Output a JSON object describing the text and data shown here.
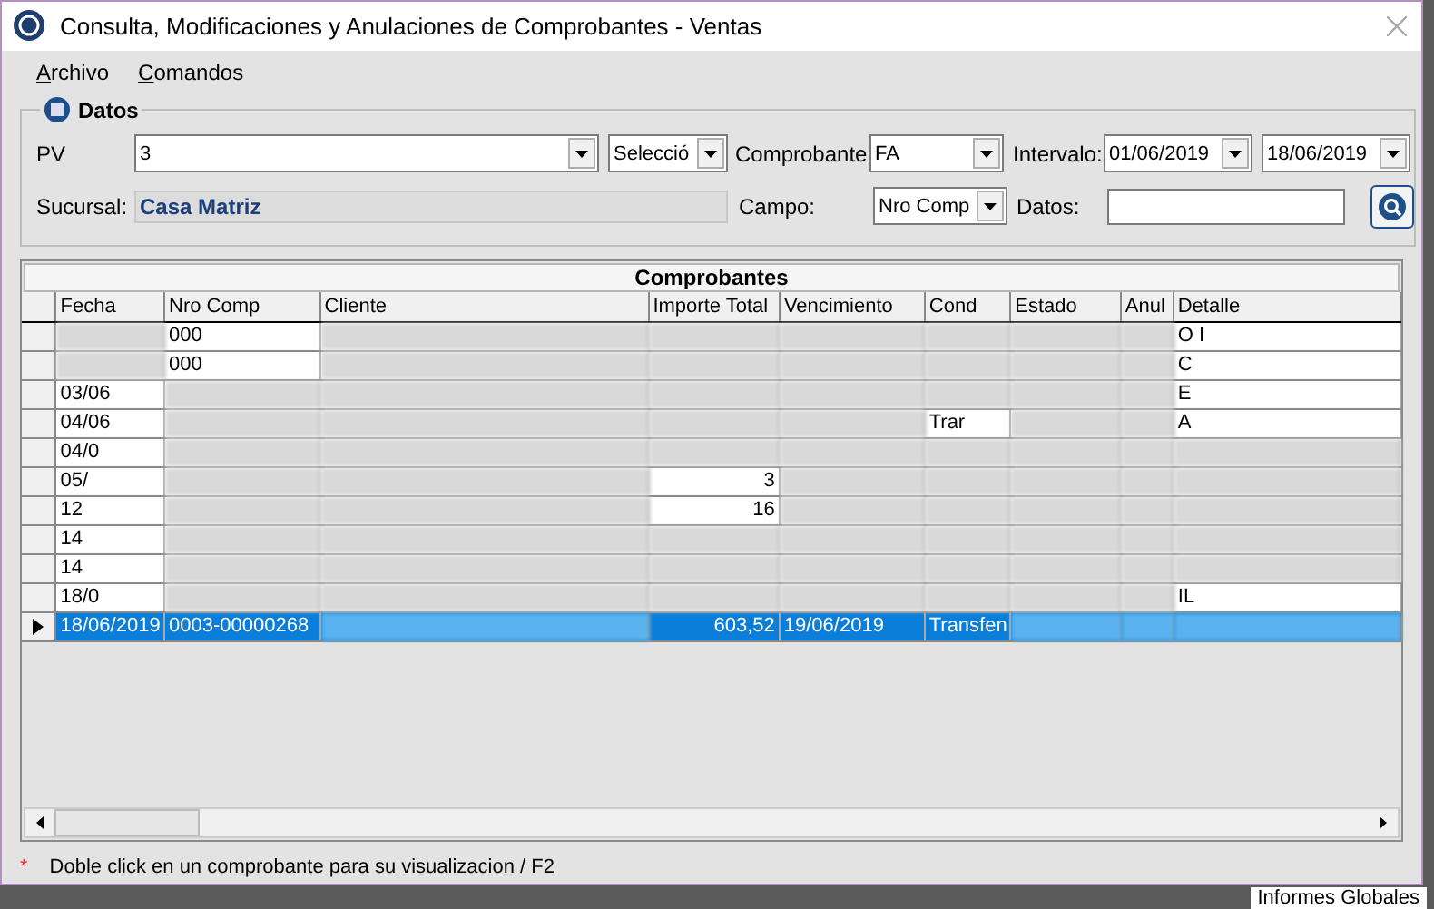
{
  "window": {
    "title": "Consulta, Modificaciones y Anulaciones de Comprobantes - Ventas"
  },
  "menu": [
    {
      "label": "Archivo"
    },
    {
      "label": "Comandos"
    }
  ],
  "datos": {
    "title": "Datos",
    "pv": {
      "label": "PV",
      "value": "3"
    },
    "pv_mode": {
      "value": "Selecció"
    },
    "comprobante": {
      "label": "Comprobante:",
      "value": "FA"
    },
    "intervalo": {
      "label": "Intervalo:",
      "from": "01/06/2019",
      "to": "18/06/2019"
    },
    "sucursal": {
      "label": "Sucursal:",
      "value": "Casa Matriz"
    },
    "campo": {
      "label": "Campo:",
      "value": "Nro Comp"
    },
    "datos_field": {
      "label": "Datos:"
    }
  },
  "table": {
    "title": "Comprobantes",
    "columns": [
      "Fecha",
      "Nro Comp",
      "Cliente",
      "Importe Total",
      "Vencimiento",
      "Cond",
      "Estado",
      "Anul",
      "Detalle"
    ],
    "rows": [
      {
        "cells": [
          "",
          "000",
          "",
          "",
          "",
          "",
          "",
          "",
          "O I"
        ],
        "selected": false,
        "blurred": true
      },
      {
        "cells": [
          "",
          "000",
          "",
          "",
          "",
          "",
          "",
          "",
          "C"
        ],
        "selected": false,
        "blurred": true
      },
      {
        "cells": [
          "03/06",
          "",
          "",
          "",
          "",
          "",
          "",
          "",
          "E"
        ],
        "selected": false,
        "blurred": true
      },
      {
        "cells": [
          "04/06",
          "",
          "",
          "",
          "",
          "Trar",
          "",
          "",
          "A"
        ],
        "selected": false,
        "blurred": true
      },
      {
        "cells": [
          "04/0",
          "",
          "",
          "",
          "",
          "",
          "",
          "",
          ""
        ],
        "selected": false,
        "blurred": true
      },
      {
        "cells": [
          "05/",
          "",
          "",
          "3",
          "",
          "",
          "",
          "",
          ""
        ],
        "selected": false,
        "blurred": true
      },
      {
        "cells": [
          "12",
          "",
          "",
          "16",
          "",
          "",
          "",
          "",
          ""
        ],
        "selected": false,
        "blurred": true
      },
      {
        "cells": [
          "14",
          "",
          "",
          "",
          "",
          "",
          "",
          "",
          ""
        ],
        "selected": false,
        "blurred": true
      },
      {
        "cells": [
          "14",
          "",
          "",
          "",
          "",
          "",
          "",
          "",
          ""
        ],
        "selected": false,
        "blurred": true
      },
      {
        "cells": [
          "18/0",
          "",
          "",
          "",
          "",
          "",
          "",
          "",
          "IL"
        ],
        "selected": false,
        "blurred": true
      },
      {
        "cells": [
          "18/06/2019",
          "0003-00000268",
          "",
          "603,52",
          "19/06/2019",
          "Transfen",
          "",
          "",
          ""
        ],
        "selected": true,
        "blurred": true
      }
    ]
  },
  "status_bar": {
    "marker": "*",
    "text": "Doble click en un comprobante para su visualizacion / F2"
  },
  "background_text": "Informes Globales"
}
